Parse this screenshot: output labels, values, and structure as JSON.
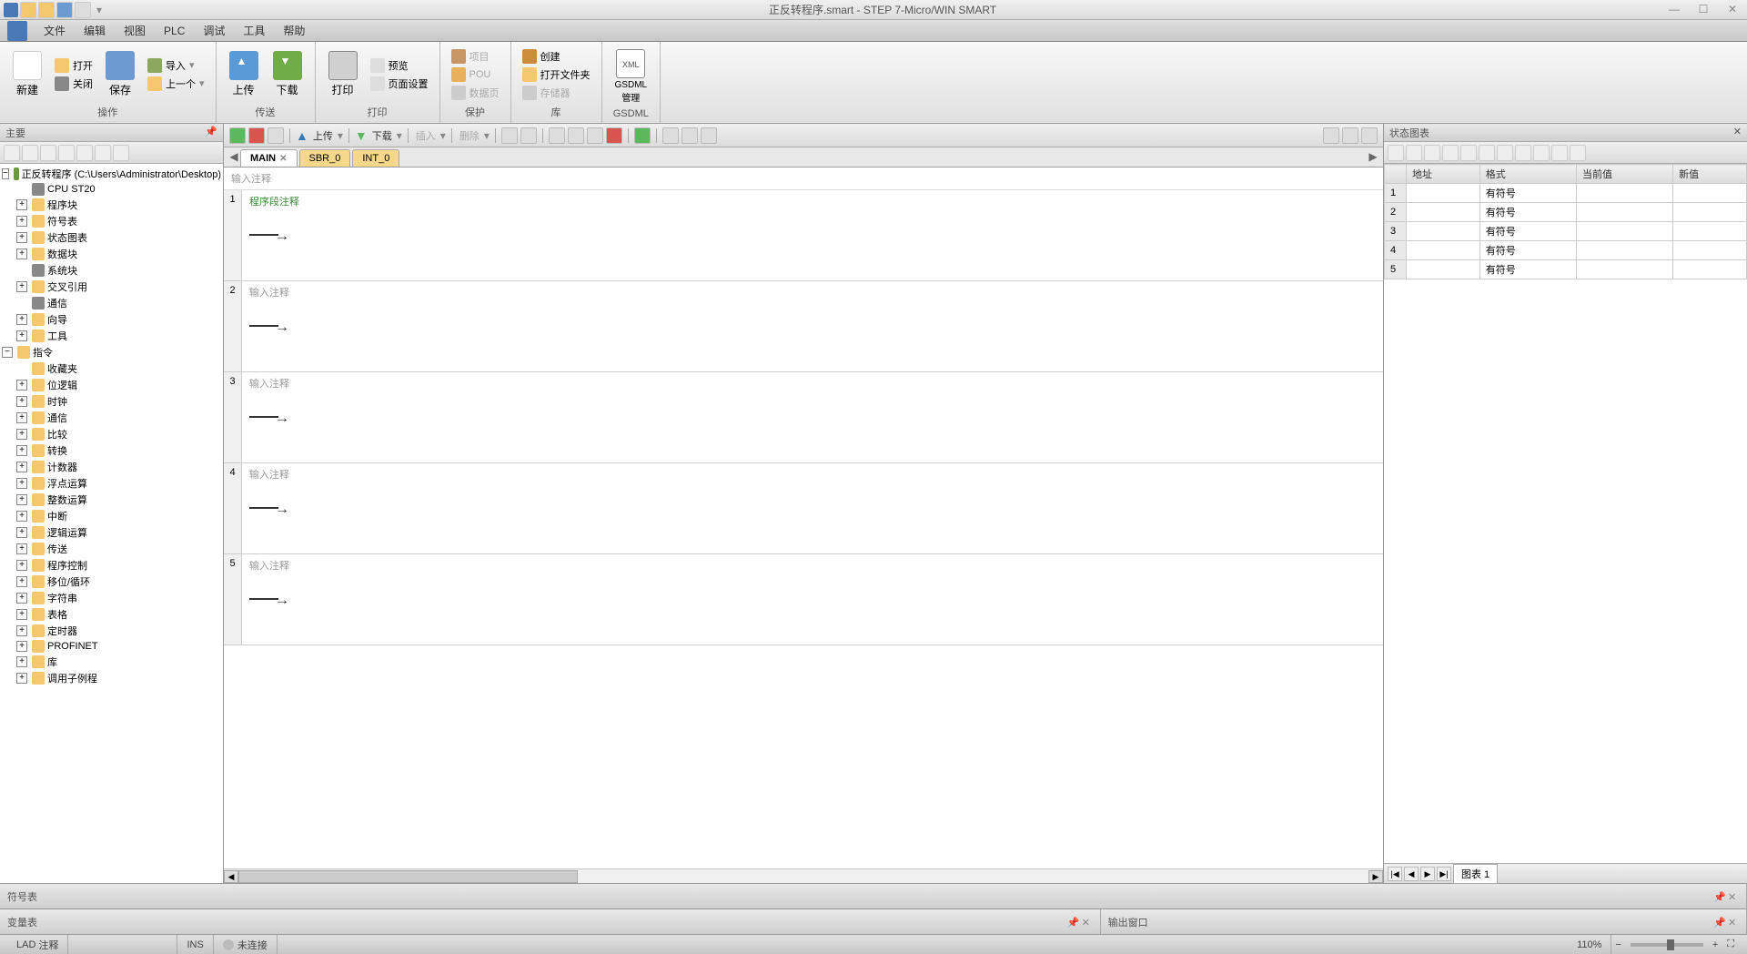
{
  "titlebar": {
    "title": "正反转程序.smart - STEP 7-Micro/WIN SMART"
  },
  "menu": {
    "file": "文件",
    "edit": "编辑",
    "view": "视图",
    "plc": "PLC",
    "debug": "调试",
    "tools": "工具",
    "help": "帮助"
  },
  "ribbon": {
    "new": "新建",
    "open": "打开",
    "close": "关闭",
    "save": "保存",
    "import": "导入",
    "export": "上一个",
    "upload": "上传",
    "download": "下载",
    "print": "打印",
    "preview": "预览",
    "pagesetup": "页面设置",
    "project": "项目",
    "pou": "POU",
    "datapage": "数据页",
    "create": "创建",
    "openfolder": "打开文件夹",
    "memory": "存储器",
    "gsdml": "GSDML\n管理",
    "group_operation": "操作",
    "group_transfer": "传送",
    "group_print": "打印",
    "group_protect": "保护",
    "group_lib": "库",
    "group_gsdml": "GSDML"
  },
  "tree": {
    "panel_title": "主要",
    "root": "正反转程序 (C:\\Users\\Administrator\\Desktop)",
    "cpu": "CPU ST20",
    "program_block": "程序块",
    "symbol_table": "符号表",
    "status_chart": "状态图表",
    "data_block": "数据块",
    "system_block": "系统块",
    "cross_ref": "交叉引用",
    "communication": "通信",
    "wizard": "向导",
    "tools": "工具",
    "instructions": "指令",
    "favorites": "收藏夹",
    "bit_logic": "位逻辑",
    "clock": "时钟",
    "comm": "通信",
    "compare": "比较",
    "convert": "转换",
    "counter": "计数器",
    "float": "浮点运算",
    "integer": "整数运算",
    "interrupt": "中断",
    "logic": "逻辑运算",
    "transfer": "传送",
    "program_control": "程序控制",
    "shift": "移位/循环",
    "string": "字符串",
    "table": "表格",
    "timer": "定时器",
    "profinet": "PROFINET",
    "library": "库",
    "call_sub": "调用子例程"
  },
  "editor_toolbar": {
    "upload": "上传",
    "download": "下载",
    "insert": "插入",
    "delete": "删除"
  },
  "tabs": {
    "main": "MAIN",
    "sbr0": "SBR_0",
    "int0": "INT_0"
  },
  "editor": {
    "header_comment": "输入注释",
    "network1_comment": "程序段注释",
    "network_comment": "输入注释",
    "n1": "1",
    "n2": "2",
    "n3": "3",
    "n4": "4",
    "n5": "5"
  },
  "status_chart": {
    "panel_title": "状态图表",
    "col_address": "地址",
    "col_format": "格式",
    "col_current": "当前值",
    "col_new": "新值",
    "format_signed": "有符号",
    "r1": "1",
    "r2": "2",
    "r3": "3",
    "r4": "4",
    "r5": "5",
    "pager_tab": "图表 1"
  },
  "bottom": {
    "symbol_table": "符号表",
    "variable_table": "变量表",
    "output_window": "输出窗口"
  },
  "statusbar": {
    "lad": "LAD",
    "comment": "注释",
    "ins": "INS",
    "not_connected": "未连接",
    "zoom": "110%"
  }
}
